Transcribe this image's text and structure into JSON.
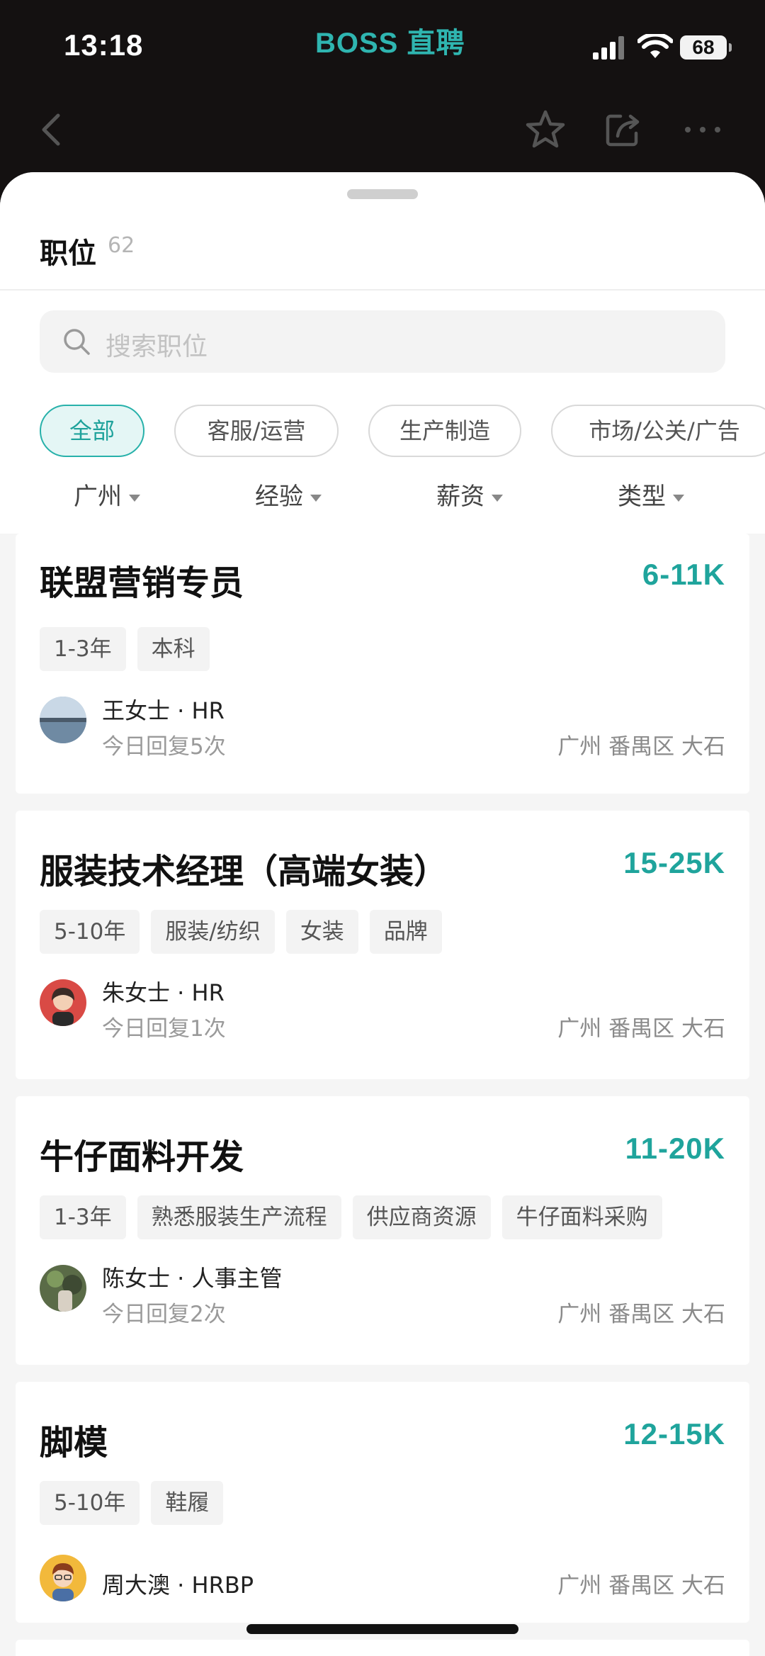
{
  "status": {
    "time": "13:18",
    "brand": "BOSS 直聘",
    "battery": "68"
  },
  "sheet": {
    "title": "职位",
    "count": "62",
    "search_placeholder": "搜索职位",
    "chips": [
      "全部",
      "客服/运营",
      "生产制造",
      "市场/公关/广告"
    ],
    "filters": [
      "广州",
      "经验",
      "薪资",
      "类型"
    ]
  },
  "jobs": [
    {
      "title": "联盟营销专员",
      "salary": "6-11K",
      "tags": [
        "1-3年",
        "本科"
      ],
      "recruiter": "王女士 · HR",
      "reply": "今日回复5次",
      "location": "广州 番禺区 大石"
    },
    {
      "title": "服装技术经理（高端女装）",
      "salary": "15-25K",
      "tags": [
        "5-10年",
        "服装/纺织",
        "女装",
        "品牌"
      ],
      "recruiter": "朱女士 · HR",
      "reply": "今日回复1次",
      "location": "广州 番禺区 大石"
    },
    {
      "title": "牛仔面料开发",
      "salary": "11-20K",
      "tags": [
        "1-3年",
        "熟悉服装生产流程",
        "供应商资源",
        "牛仔面料采购"
      ],
      "recruiter": "陈女士 · 人事主管",
      "reply": "今日回复2次",
      "location": "广州 番禺区 大石"
    },
    {
      "title": "脚模",
      "salary": "12-15K",
      "tags": [
        "5-10年",
        "鞋履"
      ],
      "recruiter": "周大澳 · HRBP",
      "location": "广州 番禺区 大石"
    }
  ],
  "colors": {
    "accent": "#1fa49c",
    "chip_active_bg": "#e4f6f5"
  }
}
